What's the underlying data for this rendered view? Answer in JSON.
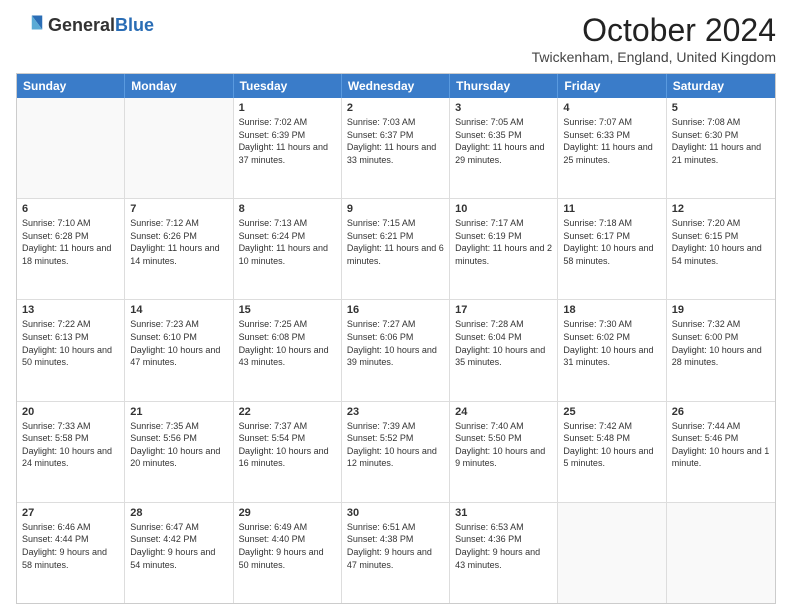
{
  "header": {
    "logo_general": "General",
    "logo_blue": "Blue",
    "month_title": "October 2024",
    "subtitle": "Twickenham, England, United Kingdom"
  },
  "weekdays": [
    "Sunday",
    "Monday",
    "Tuesday",
    "Wednesday",
    "Thursday",
    "Friday",
    "Saturday"
  ],
  "weeks": [
    [
      {
        "day": "",
        "empty": true
      },
      {
        "day": "",
        "empty": true
      },
      {
        "day": "1",
        "sunrise": "Sunrise: 7:02 AM",
        "sunset": "Sunset: 6:39 PM",
        "daylight": "Daylight: 11 hours and 37 minutes."
      },
      {
        "day": "2",
        "sunrise": "Sunrise: 7:03 AM",
        "sunset": "Sunset: 6:37 PM",
        "daylight": "Daylight: 11 hours and 33 minutes."
      },
      {
        "day": "3",
        "sunrise": "Sunrise: 7:05 AM",
        "sunset": "Sunset: 6:35 PM",
        "daylight": "Daylight: 11 hours and 29 minutes."
      },
      {
        "day": "4",
        "sunrise": "Sunrise: 7:07 AM",
        "sunset": "Sunset: 6:33 PM",
        "daylight": "Daylight: 11 hours and 25 minutes."
      },
      {
        "day": "5",
        "sunrise": "Sunrise: 7:08 AM",
        "sunset": "Sunset: 6:30 PM",
        "daylight": "Daylight: 11 hours and 21 minutes."
      }
    ],
    [
      {
        "day": "6",
        "sunrise": "Sunrise: 7:10 AM",
        "sunset": "Sunset: 6:28 PM",
        "daylight": "Daylight: 11 hours and 18 minutes."
      },
      {
        "day": "7",
        "sunrise": "Sunrise: 7:12 AM",
        "sunset": "Sunset: 6:26 PM",
        "daylight": "Daylight: 11 hours and 14 minutes."
      },
      {
        "day": "8",
        "sunrise": "Sunrise: 7:13 AM",
        "sunset": "Sunset: 6:24 PM",
        "daylight": "Daylight: 11 hours and 10 minutes."
      },
      {
        "day": "9",
        "sunrise": "Sunrise: 7:15 AM",
        "sunset": "Sunset: 6:21 PM",
        "daylight": "Daylight: 11 hours and 6 minutes."
      },
      {
        "day": "10",
        "sunrise": "Sunrise: 7:17 AM",
        "sunset": "Sunset: 6:19 PM",
        "daylight": "Daylight: 11 hours and 2 minutes."
      },
      {
        "day": "11",
        "sunrise": "Sunrise: 7:18 AM",
        "sunset": "Sunset: 6:17 PM",
        "daylight": "Daylight: 10 hours and 58 minutes."
      },
      {
        "day": "12",
        "sunrise": "Sunrise: 7:20 AM",
        "sunset": "Sunset: 6:15 PM",
        "daylight": "Daylight: 10 hours and 54 minutes."
      }
    ],
    [
      {
        "day": "13",
        "sunrise": "Sunrise: 7:22 AM",
        "sunset": "Sunset: 6:13 PM",
        "daylight": "Daylight: 10 hours and 50 minutes."
      },
      {
        "day": "14",
        "sunrise": "Sunrise: 7:23 AM",
        "sunset": "Sunset: 6:10 PM",
        "daylight": "Daylight: 10 hours and 47 minutes."
      },
      {
        "day": "15",
        "sunrise": "Sunrise: 7:25 AM",
        "sunset": "Sunset: 6:08 PM",
        "daylight": "Daylight: 10 hours and 43 minutes."
      },
      {
        "day": "16",
        "sunrise": "Sunrise: 7:27 AM",
        "sunset": "Sunset: 6:06 PM",
        "daylight": "Daylight: 10 hours and 39 minutes."
      },
      {
        "day": "17",
        "sunrise": "Sunrise: 7:28 AM",
        "sunset": "Sunset: 6:04 PM",
        "daylight": "Daylight: 10 hours and 35 minutes."
      },
      {
        "day": "18",
        "sunrise": "Sunrise: 7:30 AM",
        "sunset": "Sunset: 6:02 PM",
        "daylight": "Daylight: 10 hours and 31 minutes."
      },
      {
        "day": "19",
        "sunrise": "Sunrise: 7:32 AM",
        "sunset": "Sunset: 6:00 PM",
        "daylight": "Daylight: 10 hours and 28 minutes."
      }
    ],
    [
      {
        "day": "20",
        "sunrise": "Sunrise: 7:33 AM",
        "sunset": "Sunset: 5:58 PM",
        "daylight": "Daylight: 10 hours and 24 minutes."
      },
      {
        "day": "21",
        "sunrise": "Sunrise: 7:35 AM",
        "sunset": "Sunset: 5:56 PM",
        "daylight": "Daylight: 10 hours and 20 minutes."
      },
      {
        "day": "22",
        "sunrise": "Sunrise: 7:37 AM",
        "sunset": "Sunset: 5:54 PM",
        "daylight": "Daylight: 10 hours and 16 minutes."
      },
      {
        "day": "23",
        "sunrise": "Sunrise: 7:39 AM",
        "sunset": "Sunset: 5:52 PM",
        "daylight": "Daylight: 10 hours and 12 minutes."
      },
      {
        "day": "24",
        "sunrise": "Sunrise: 7:40 AM",
        "sunset": "Sunset: 5:50 PM",
        "daylight": "Daylight: 10 hours and 9 minutes."
      },
      {
        "day": "25",
        "sunrise": "Sunrise: 7:42 AM",
        "sunset": "Sunset: 5:48 PM",
        "daylight": "Daylight: 10 hours and 5 minutes."
      },
      {
        "day": "26",
        "sunrise": "Sunrise: 7:44 AM",
        "sunset": "Sunset: 5:46 PM",
        "daylight": "Daylight: 10 hours and 1 minute."
      }
    ],
    [
      {
        "day": "27",
        "sunrise": "Sunrise: 6:46 AM",
        "sunset": "Sunset: 4:44 PM",
        "daylight": "Daylight: 9 hours and 58 minutes."
      },
      {
        "day": "28",
        "sunrise": "Sunrise: 6:47 AM",
        "sunset": "Sunset: 4:42 PM",
        "daylight": "Daylight: 9 hours and 54 minutes."
      },
      {
        "day": "29",
        "sunrise": "Sunrise: 6:49 AM",
        "sunset": "Sunset: 4:40 PM",
        "daylight": "Daylight: 9 hours and 50 minutes."
      },
      {
        "day": "30",
        "sunrise": "Sunrise: 6:51 AM",
        "sunset": "Sunset: 4:38 PM",
        "daylight": "Daylight: 9 hours and 47 minutes."
      },
      {
        "day": "31",
        "sunrise": "Sunrise: 6:53 AM",
        "sunset": "Sunset: 4:36 PM",
        "daylight": "Daylight: 9 hours and 43 minutes."
      },
      {
        "day": "",
        "empty": true
      },
      {
        "day": "",
        "empty": true
      }
    ]
  ]
}
